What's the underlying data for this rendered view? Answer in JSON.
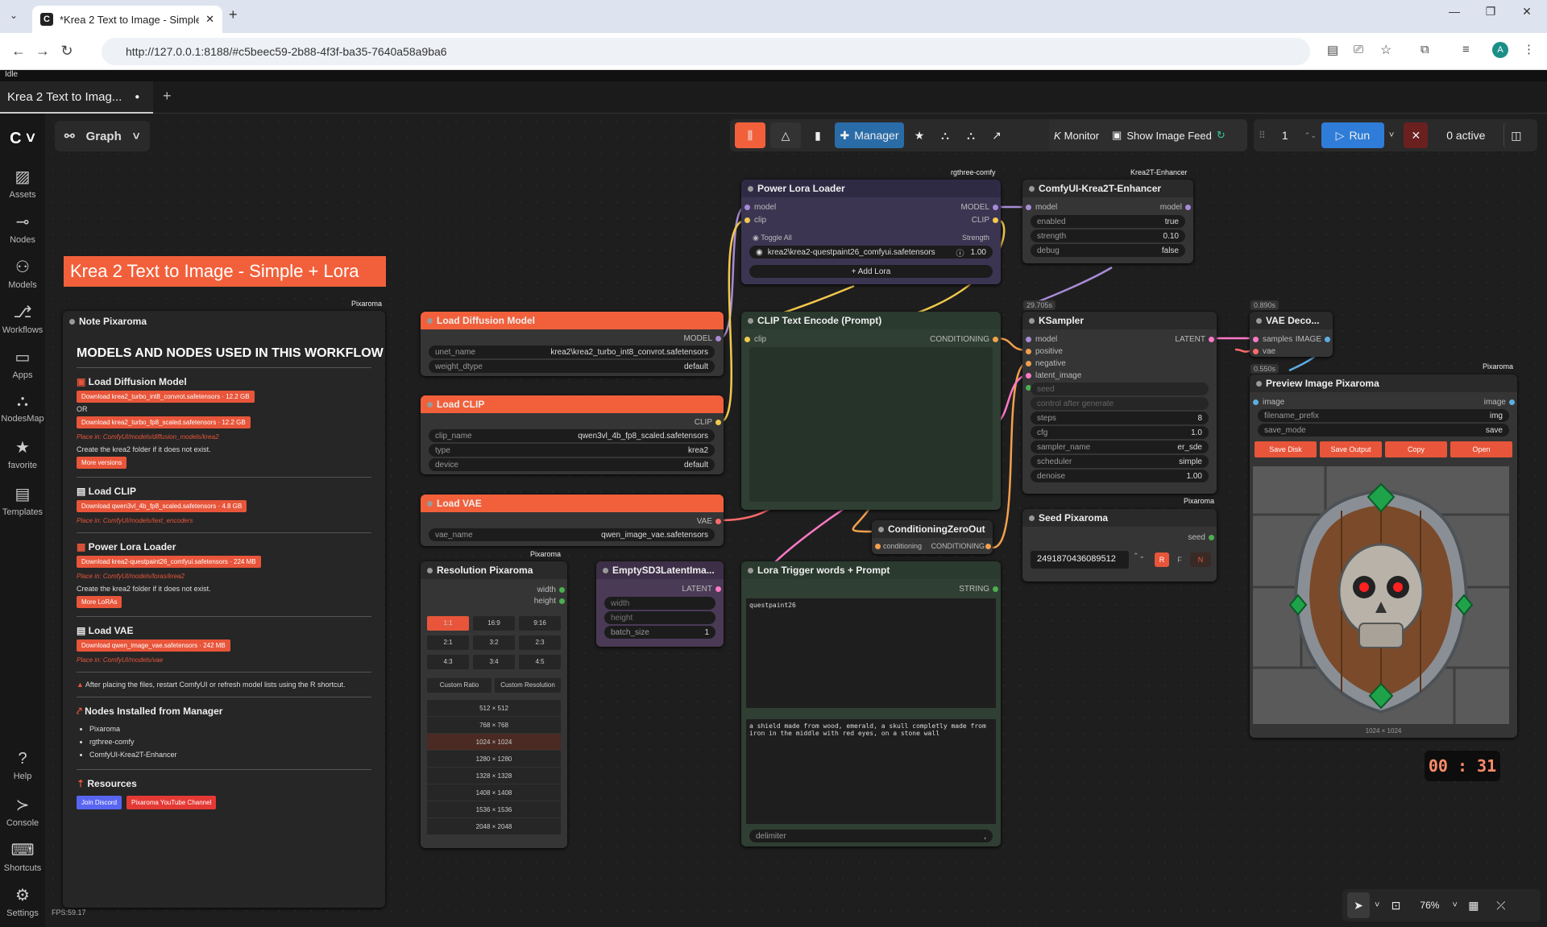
{
  "browser": {
    "tab_title": "*Krea 2 Text to Image - Simple",
    "url": "http://127.0.0.1:8188/#c5beec59-2b88-4f3f-ba35-7640a58a9ba6",
    "profile": "A"
  },
  "status": "Idle",
  "workflow_tab": "Krea 2 Text to Imag...",
  "graph_label": "Graph",
  "sidebar": [
    {
      "label": "Assets",
      "icon": "assets-icon"
    },
    {
      "label": "Nodes",
      "icon": "nodes-icon"
    },
    {
      "label": "Models",
      "icon": "models-icon"
    },
    {
      "label": "Workflows",
      "icon": "workflows-icon"
    },
    {
      "label": "Apps",
      "icon": "apps-icon"
    },
    {
      "label": "NodesMap",
      "icon": "nodesmap-icon"
    },
    {
      "label": "favorite",
      "icon": "star-icon"
    },
    {
      "label": "Templates",
      "icon": "templates-icon"
    },
    {
      "label": "Help",
      "icon": "help-icon"
    },
    {
      "label": "Console",
      "icon": "console-icon"
    },
    {
      "label": "Shortcuts",
      "icon": "keyboard-icon"
    },
    {
      "label": "Settings",
      "icon": "gear-icon"
    }
  ],
  "toolbar": {
    "manager": "Manager",
    "monitor": "Monitor",
    "show_feed": "Show Image Feed",
    "batch": "1",
    "run": "Run",
    "active": "0 active"
  },
  "title_banner": "Krea 2 Text to Image - Simple + Lora",
  "note": {
    "badge": "Pixaroma",
    "title": "Note Pixaroma",
    "heading": "MODELS AND NODES USED IN THIS WORKFLOW",
    "s1": "Load Diffusion Model",
    "d1a": "Download krea2_turbo_int8_convrot.safetensors · 12.2 GB",
    "or": "OR",
    "d1b": "Download krea2_turbo_fp8_scaled.safetensors · 12.2 GB",
    "p1": "Place in: ComfyUI/models/diffusion_models/krea2",
    "c1": "Create the  krea2  folder if it does not exist.",
    "m1": "More versions",
    "s2": "Load CLIP",
    "d2": "Download qwen3vl_4b_fp8_scaled.safetensors · 4.8 GB",
    "p2": "Place in: ComfyUI/models/text_encoders",
    "s3": "Power Lora Loader",
    "d3": "Download krea2-questpaint26_comfyui.safetensors · 224 MB",
    "p3": "Place in: ComfyUI/models/loras/krea2",
    "c3": "Create the  krea2  folder if it does not exist.",
    "m3": "More LoRAs",
    "s4": "Load VAE",
    "d4": "Download qwen_image_vae.safetensors · 242 MB",
    "p4": "Place in: ComfyUI/models/vae",
    "warn": "After placing the files, restart ComfyUI or refresh model lists using the R shortcut.",
    "s5": "Nodes Installed from Manager",
    "n1": "Pixaroma",
    "n2": "rgthree-comfy",
    "n3": "ComfyUI-Krea2T-Enhancer",
    "s6": "Resources",
    "r1": "Join Discord",
    "r2": "Pixaroma YouTube Channel",
    "fps": "FPS:59.17"
  },
  "nodes": {
    "diff": {
      "title": "Load Diffusion Model",
      "out": "MODEL",
      "w1": "unet_name",
      "v1": "krea2\\krea2_turbo_int8_convrot.safetensors",
      "w2": "weight_dtype",
      "v2": "default"
    },
    "clip": {
      "title": "Load CLIP",
      "out": "CLIP",
      "w1": "clip_name",
      "v1": "qwen3vl_4b_fp8_scaled.safetensors",
      "w2": "type",
      "v2": "krea2",
      "w3": "device",
      "v3": "default"
    },
    "vae": {
      "title": "Load VAE",
      "out": "VAE",
      "w1": "vae_name",
      "v1": "qwen_image_vae.safetensors"
    },
    "lora": {
      "title": "Power Lora Loader",
      "badge": "rgthree-comfy",
      "in1": "model",
      "in2": "clip",
      "out1": "MODEL",
      "out2": "CLIP",
      "toggle": "Toggle All",
      "strength": "Strength",
      "lora": "krea2\\krea2-questpaint26_comfyui.safetensors",
      "lval": "1.00",
      "add": "+ Add Lora"
    },
    "enh": {
      "title": "ComfyUI-Krea2T-Enhancer",
      "badge": "Krea2T-Enhancer",
      "in": "model",
      "out": "model",
      "w1": "enabled",
      "v1": "true",
      "w2": "strength",
      "v2": "0.10",
      "w3": "debug",
      "v3": "false"
    },
    "cte": {
      "title": "CLIP Text Encode (Prompt)",
      "in": "clip",
      "out": "CONDITIONING"
    },
    "ks": {
      "title": "KSampler",
      "time": "29.705s",
      "in": [
        "model",
        "positive",
        "negative",
        "latent_image"
      ],
      "out": "LATENT",
      "seed": "seed",
      "cag": "control after generate",
      "w": [
        [
          "steps",
          "8"
        ],
        [
          "cfg",
          "1.0"
        ],
        [
          "sampler_name",
          "er_sde"
        ],
        [
          "scheduler",
          "simple"
        ],
        [
          "denoise",
          "1.00"
        ]
      ]
    },
    "vaed": {
      "title": "VAE Deco...",
      "time": "0.890s",
      "in1": "samples",
      "in2": "vae",
      "out": "IMAGE"
    },
    "prev": {
      "title": "Preview Image Pixaroma",
      "badge": "Pixaroma",
      "time": "0.550s",
      "in": "image",
      "out": "image",
      "w1": "filename_prefix",
      "v1": "img",
      "w2": "save_mode",
      "v2": "save",
      "b1": "Save Disk",
      "b2": "Save Output",
      "b3": "Copy",
      "b4": "Open",
      "size": "1024 × 1024"
    },
    "czo": {
      "title": "ConditioningZeroOut",
      "in": "conditioning",
      "out": "CONDITIONING"
    },
    "seed": {
      "title": "Seed Pixaroma",
      "badge": "Pixaroma",
      "out": "seed",
      "val": "2491870436089512",
      "r": "R",
      "f": "F",
      "n": "N"
    },
    "res": {
      "title": "Resolution Pixaroma",
      "badge": "Pixaroma",
      "o1": "width",
      "o2": "height",
      "ratios": [
        "1:1",
        "16:9",
        "9:16",
        "2:1",
        "3:2",
        "2:3",
        "4:3",
        "3:4",
        "4:5"
      ],
      "custom1": "Custom Ratio",
      "custom2": "Custom Resolution",
      "sizes": [
        "512 × 512",
        "768 × 768",
        "1024 × 1024",
        "1280 × 1280",
        "1328 × 1328",
        "1408 × 1408",
        "1536 × 1536",
        "2048 × 2048"
      ]
    },
    "lat": {
      "title": "EmptySD3LatentIma...",
      "out": "LATENT",
      "w1": "width",
      "w2": "height",
      "w3": "batch_size",
      "v3": "1"
    },
    "ltw": {
      "title": "Lora Trigger words + Prompt",
      "out": "STRING",
      "t1": "questpaint26",
      "t2": "a shield made from wood, emerald, a skull completly made from iron in the middle with red eyes, on a stone wall",
      "delim": "delimiter"
    }
  },
  "timer": "00 : 31",
  "zoom": "76%"
}
